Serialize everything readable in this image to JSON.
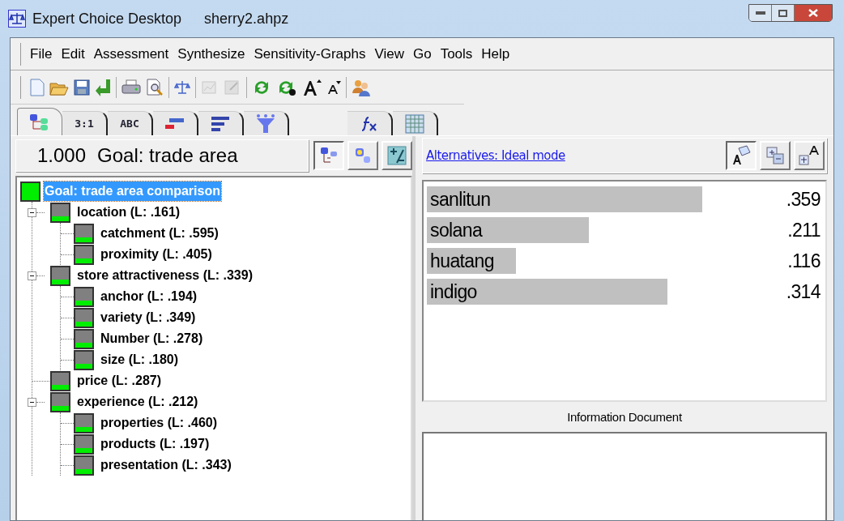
{
  "window": {
    "title": "Expert Choice Desktop",
    "document": "sherry2.ahpz"
  },
  "menu": [
    "File",
    "Edit",
    "Assessment",
    "Synthesize",
    "Sensitivity-Graphs",
    "View",
    "Go",
    "Tools",
    "Help"
  ],
  "tabs": [
    {
      "kind": "icon",
      "selected": true
    },
    {
      "kind": "text",
      "label": "3:1",
      "selected": false
    },
    {
      "kind": "text",
      "label": "ABC",
      "selected": false
    },
    {
      "kind": "icon",
      "selected": false
    },
    {
      "kind": "icon",
      "selected": false
    },
    {
      "kind": "icon",
      "selected": false
    },
    {
      "kind": "icon",
      "selected": false
    },
    {
      "kind": "icon",
      "selected": false
    }
  ],
  "goal_header": {
    "value": "1.000",
    "title": "Goal: trade area",
    "view_buttons": [
      {
        "pressed": true
      },
      {
        "pressed": false
      },
      {
        "pressed": false
      }
    ]
  },
  "tree": {
    "label": "Goal: trade area comparison",
    "selected": true,
    "children": [
      {
        "label": "location (L: .161)",
        "expanded": true,
        "children": [
          {
            "label": "catchment (L: .595)"
          },
          {
            "label": "proximity (L: .405)"
          }
        ]
      },
      {
        "label": "store attractiveness (L: .339)",
        "expanded": true,
        "children": [
          {
            "label": "anchor (L: .194)"
          },
          {
            "label": "variety (L: .349)"
          },
          {
            "label": "Number (L: .278)"
          },
          {
            "label": "size (L: .180)"
          }
        ]
      },
      {
        "label": "price (L: .287)"
      },
      {
        "label": "experience (L: .212)",
        "expanded": true,
        "children": [
          {
            "label": "properties (L: .460)"
          },
          {
            "label": "products (L: .197)"
          },
          {
            "label": "presentation (L: .343)"
          }
        ]
      }
    ]
  },
  "alternatives": {
    "mode_link": "Alternatives: Ideal mode",
    "view_buttons": [
      {
        "pressed": true
      },
      {
        "pressed": false
      },
      {
        "pressed": false
      }
    ],
    "items": [
      {
        "name": "sanlitun",
        "value": ".359"
      },
      {
        "name": "solana",
        "value": ".211"
      },
      {
        "name": "huatang",
        "value": ".116"
      },
      {
        "name": "indigo",
        "value": ".314"
      }
    ]
  },
  "information_document": {
    "title": "Information Document"
  }
}
